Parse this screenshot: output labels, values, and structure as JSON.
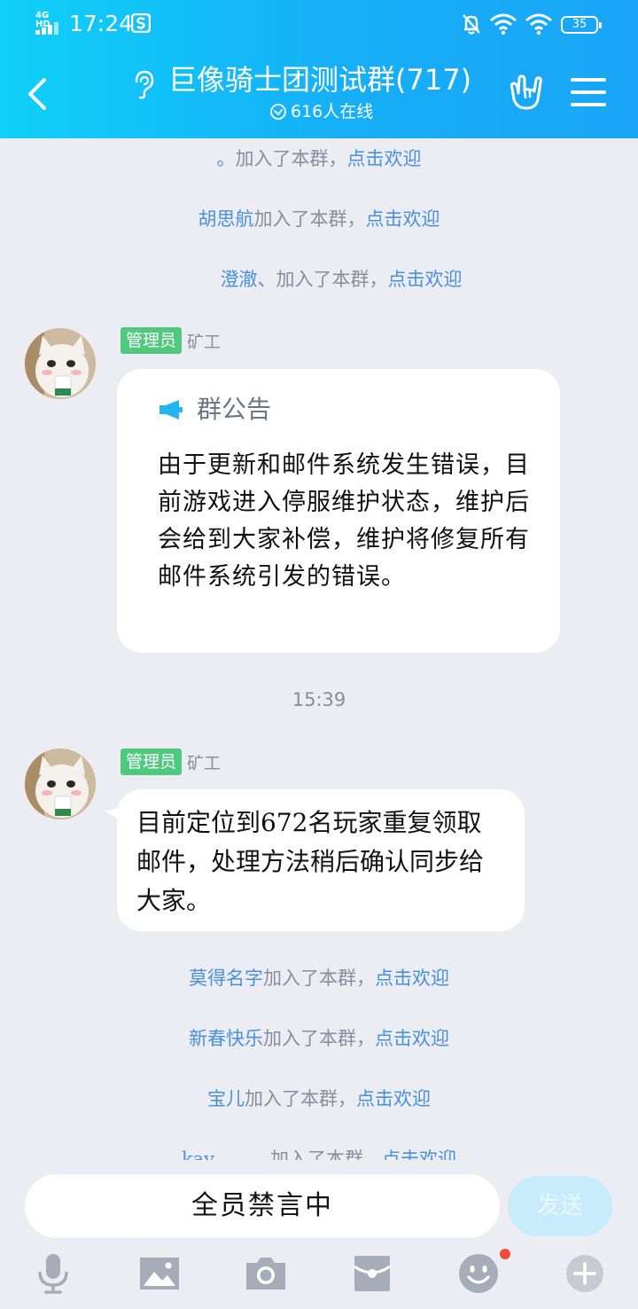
{
  "status_bar": {
    "network": "4G HD",
    "time": "17:24",
    "battery": "35"
  },
  "header": {
    "title": "巨像骑士团测试群(717)",
    "online": "616人在线",
    "icons": [
      "back-icon",
      "ear-icon",
      "rock-gesture-icon",
      "menu-icon"
    ]
  },
  "system_messages_top": [
    {
      "name": "。",
      "text": "加入了本群，",
      "action": "点击欢迎"
    },
    {
      "name": "胡思航",
      "text": "加入了本群，",
      "action": "点击欢迎"
    },
    {
      "name": "澄澈、",
      "text": "加入了本群，",
      "action": "点击欢迎"
    }
  ],
  "messages": [
    {
      "badge": "管理员",
      "sender": "矿工",
      "type": "notice",
      "notice_title": "群公告",
      "notice_body": "由于更新和邮件系统发生错误，目前游戏进入停服维护状态，维护后会给到大家补偿，维护将修复所有邮件系统引发的错误。"
    },
    {
      "badge": "管理员",
      "sender": "矿工",
      "type": "text",
      "text": "目前定位到672名玩家重复领取邮件，处理方法稍后确认同步给大家。"
    }
  ],
  "time_divider": "15:39",
  "system_messages_bottom": [
    {
      "name": "莫得名字",
      "text": "加入了本群，",
      "action": "点击欢迎"
    },
    {
      "name": "新春快乐",
      "text": "加入了本群，",
      "action": "点击欢迎"
    },
    {
      "name": "宝儿",
      "text": "加入了本群，",
      "action": "点击欢迎"
    },
    {
      "name": "kay",
      "text": "加入了本群，",
      "action": "点击欢迎"
    }
  ],
  "input_bar": {
    "muted_text": "全员禁言中",
    "send_label": "发送",
    "tools": [
      "microphone-icon",
      "image-icon",
      "camera-icon",
      "red-packet-icon",
      "emoji-icon",
      "plus-icon"
    ]
  },
  "colors": {
    "header_start": "#0fd0f8",
    "header_end": "#1aa5f6",
    "admin_badge": "#4fc97e",
    "link": "#4a90d9",
    "background": "#ebedf3"
  }
}
